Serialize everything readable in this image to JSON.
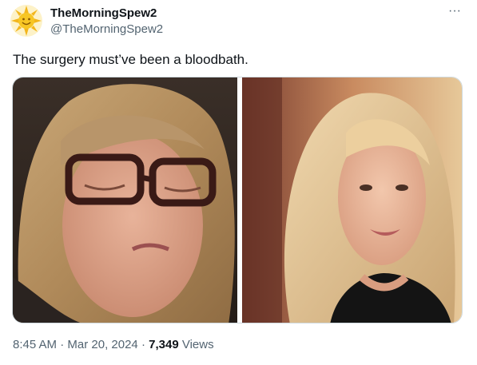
{
  "tweet": {
    "author": {
      "display_name": "TheMorningSpew2",
      "handle": "@TheMorningSpew2",
      "avatar_icon": "sun-avatar-icon"
    },
    "more_icon": "···",
    "text": "The surgery must’ve been a bloodbath.",
    "media": [
      {
        "icon": "photo-woman-glasses"
      },
      {
        "icon": "photo-woman-blonde"
      }
    ],
    "meta": {
      "time": "8:45 AM",
      "separator": " · ",
      "date": "Mar 20, 2024",
      "views_count": "7,349",
      "views_label": " Views"
    }
  },
  "colors": {
    "text_primary": "#0f1419",
    "text_secondary": "#536471",
    "border": "#cfd9de",
    "background": "#ffffff"
  }
}
